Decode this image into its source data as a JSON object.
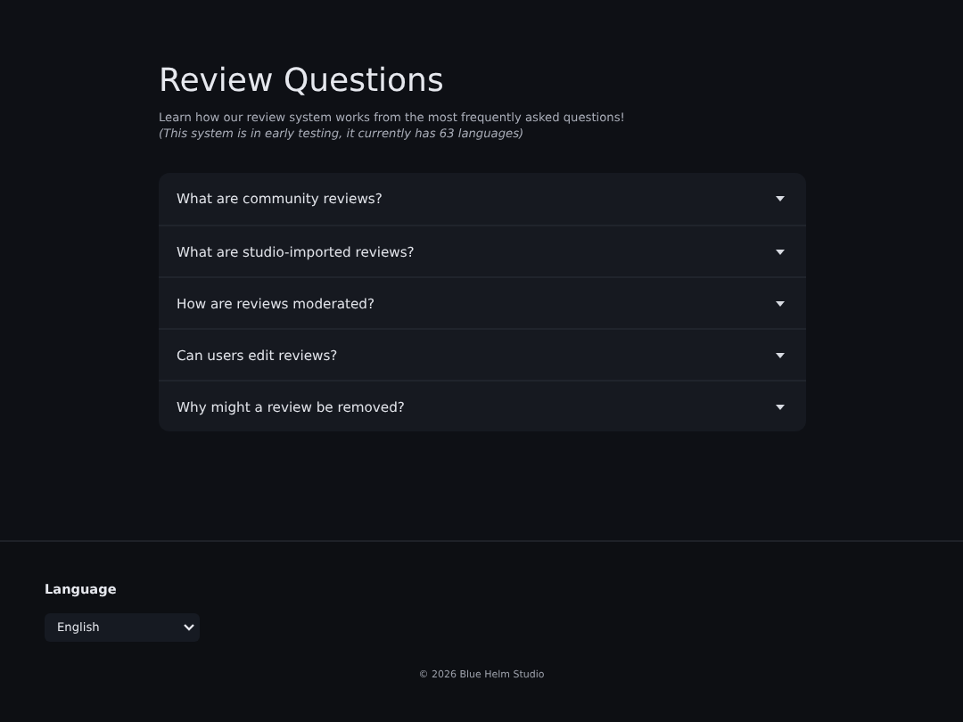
{
  "page": {
    "title": "Review Questions",
    "intro": "Learn how our review system works from the most frequently asked questions!",
    "note": "(This system is in early testing, it currently has 63 languages)"
  },
  "faq": [
    {
      "question": "What are community reviews?",
      "expanded": false
    },
    {
      "question": "What are studio-imported reviews?",
      "expanded": false
    },
    {
      "question": "How are reviews moderated?",
      "expanded": false
    },
    {
      "question": "Can users edit reviews?",
      "expanded": false
    },
    {
      "question": "Why might a review be removed?",
      "expanded": false
    }
  ],
  "footer": {
    "language_label": "Language",
    "language_value": "English",
    "copyright": "© 2026 Blue Helm Studio"
  }
}
